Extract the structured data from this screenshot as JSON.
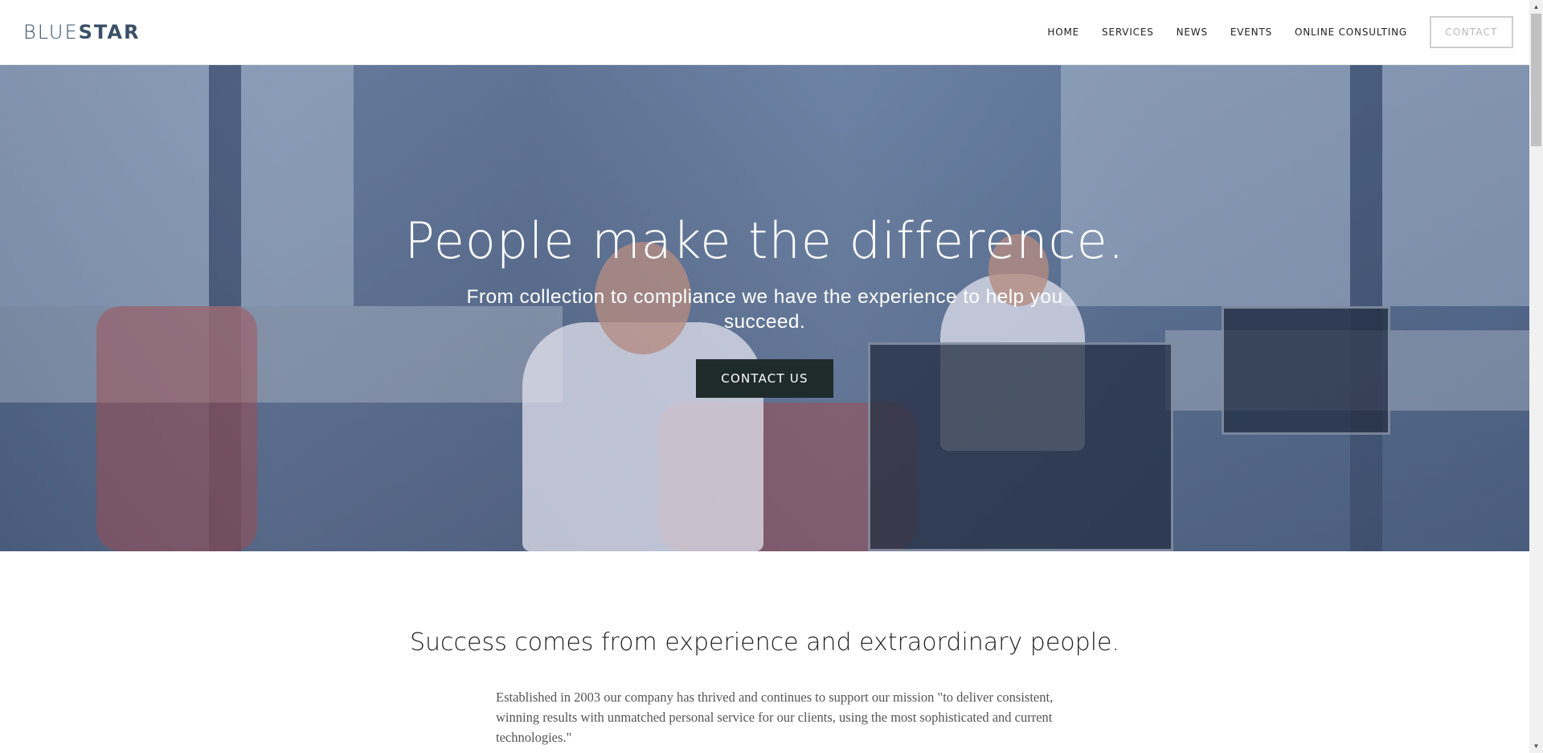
{
  "brand": {
    "light": "BLUE",
    "bold": "STAR"
  },
  "nav": {
    "items": [
      "HOME",
      "SERVICES",
      "NEWS",
      "EVENTS",
      "ONLINE CONSULTING"
    ],
    "contact_label": "CONTACT"
  },
  "hero": {
    "title": "People make the difference.",
    "subtitle": "From collection to compliance we have the experience to help you succeed.",
    "cta_label": "CONTACT US"
  },
  "about": {
    "heading": "Success comes from experience and extraordinary people.",
    "body": "Established in 2003 our company has thrived and continues to support our mission  \"to deliver consistent, winning results with unmatched personal service for our clients, using the most sophisticated and current technologies.\""
  },
  "scrollbar": {
    "up_icon": "▲",
    "down_icon": "▼"
  },
  "colors": {
    "logo": "#3b4f66",
    "cta_bg": "#1f2b2b",
    "hero_overlay": "#526a92"
  }
}
